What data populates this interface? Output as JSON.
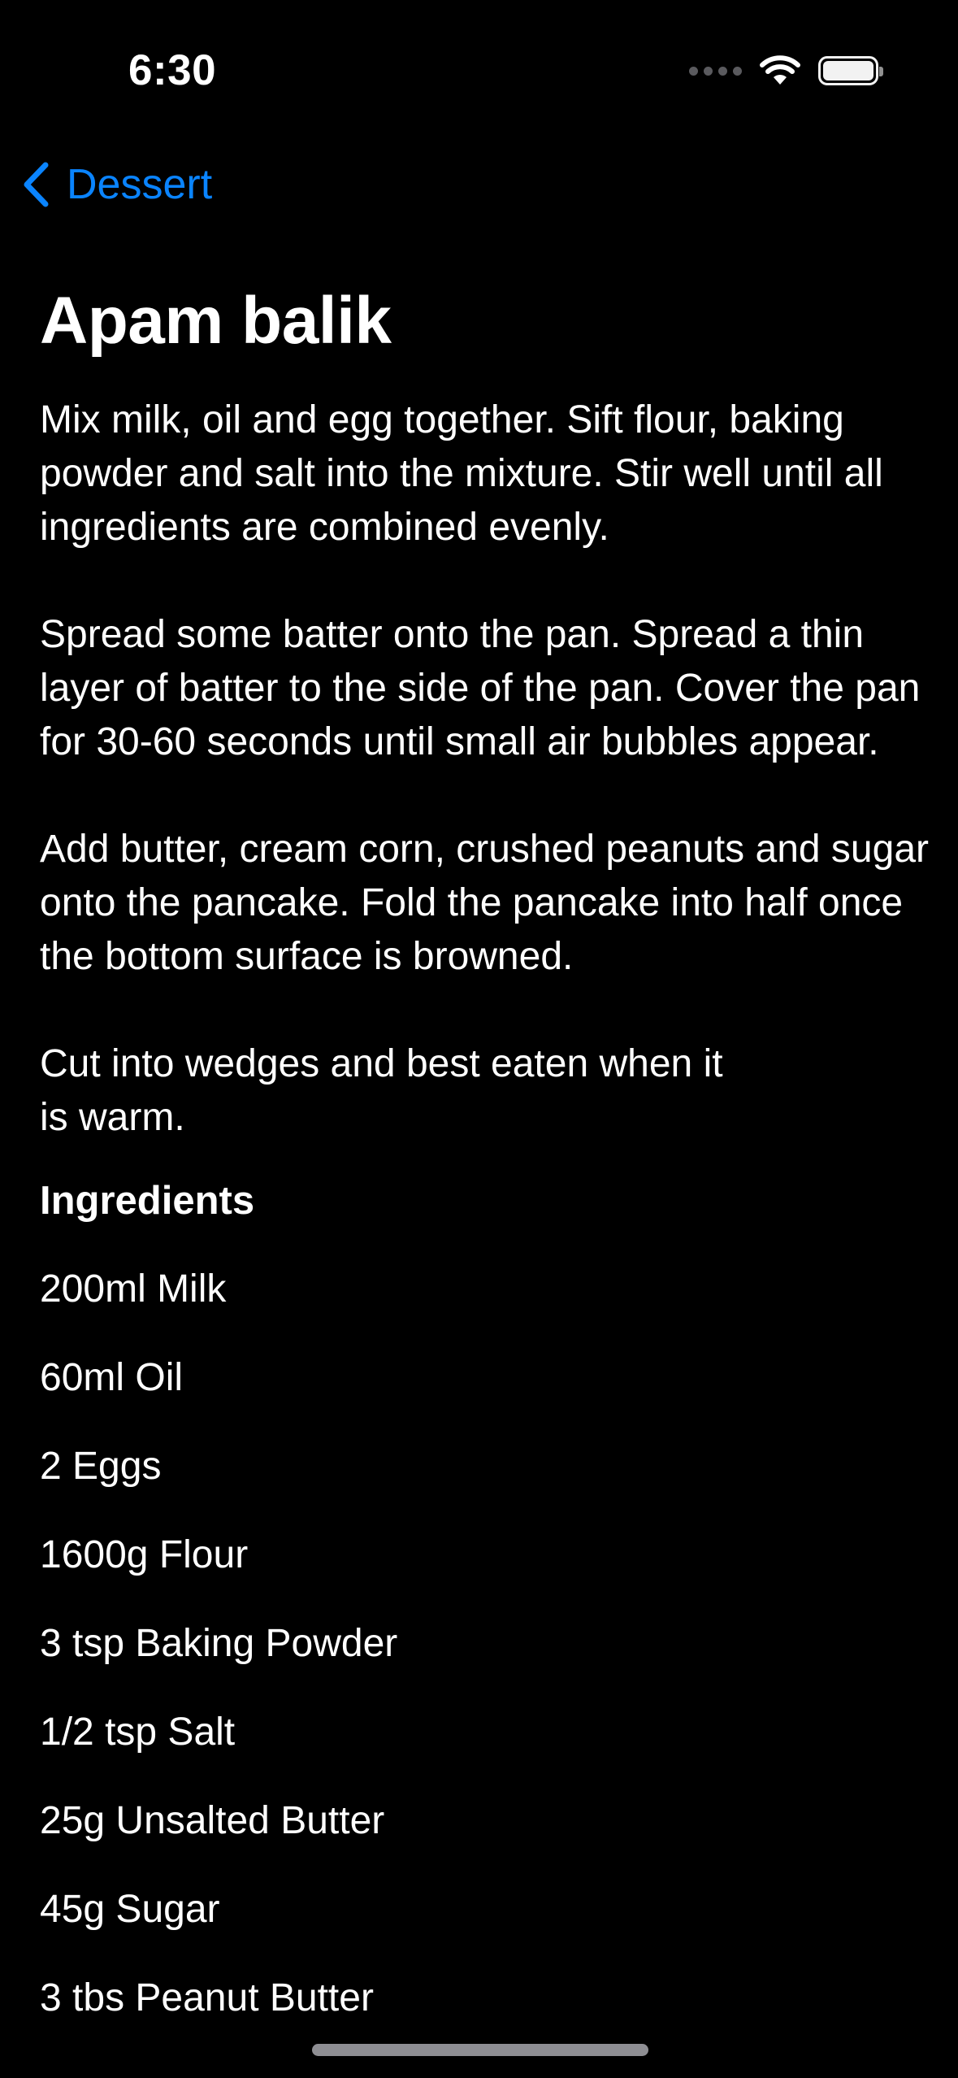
{
  "status_bar": {
    "time": "6:30",
    "icons": [
      "cellular-signal-icon",
      "wifi-icon",
      "battery-icon"
    ]
  },
  "nav": {
    "back_label": "Dessert",
    "accent_color": "#0a84ff"
  },
  "recipe": {
    "title": "Apam balik",
    "instructions": "Mix milk, oil and egg together. Sift flour, baking powder and salt into the mixture. Stir well until all ingredients are combined evenly.\n\nSpread some batter onto the pan. Spread a thin layer of batter to the side of the pan. Cover the pan for 30-60 seconds until small air bubbles appear.\n\nAdd butter, cream corn, crushed peanuts and sugar onto the pancake. Fold the pancake into half once the bottom surface is browned.\n\nCut into wedges and best eaten when it\nis warm.",
    "ingredients_heading": "Ingredients",
    "ingredients": [
      "200ml Milk",
      "60ml Oil",
      "2 Eggs",
      "1600g Flour",
      "3 tsp Baking Powder",
      "1/2 tsp Salt",
      "25g Unsalted Butter",
      "45g Sugar",
      "3 tbs Peanut Butter"
    ]
  }
}
